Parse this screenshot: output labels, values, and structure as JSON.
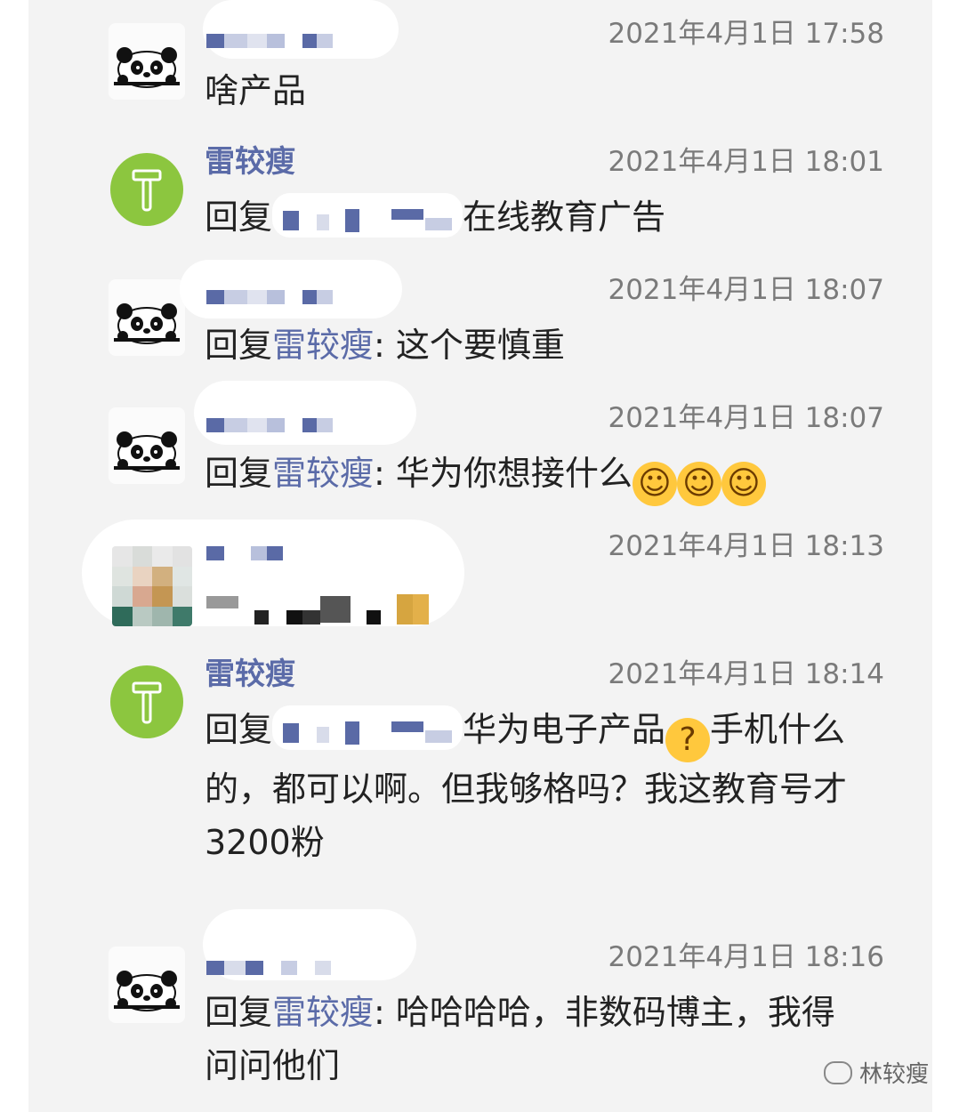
{
  "messages": [
    {
      "sender": "",
      "time": "2021年4月1日 17:58",
      "text": "啥产品"
    },
    {
      "sender": "雷较瘦",
      "time": "2021年4月1日 18:01",
      "reply_prefix": "回复",
      "text": "在线教育广告"
    },
    {
      "sender": "",
      "time": "2021年4月1日 18:07",
      "reply_prefix": "回复",
      "mention": "雷较瘦",
      "text": ": 这个要慎重"
    },
    {
      "sender": "",
      "time": "2021年4月1日 18:07",
      "reply_prefix": "回复",
      "mention": "雷较瘦",
      "text": ": 华为你想接什么"
    },
    {
      "sender": "",
      "time": "2021年4月1日 18:13",
      "text": ""
    },
    {
      "sender": "雷较瘦",
      "time": "2021年4月1日 18:14",
      "reply_prefix": "回复",
      "text_line1": "华为电子产品",
      "text_line1b": "手机什么",
      "text_line2": "的，都可以啊。但我够格吗？我这教育号才",
      "text_line3": "3200粉"
    },
    {
      "sender": "",
      "time": "2021年4月1日 18:16",
      "reply_prefix": "回复",
      "mention": "雷较瘦",
      "text_line1": ": 哈哈哈哈，非数码博主，我得",
      "text_line2": "问问他们"
    }
  ],
  "watermark": "林较瘦",
  "colors": {
    "mention": "#5b6ba8",
    "avatar_green": "#8cc63f",
    "panel_bg": "#f3f3f3"
  },
  "icons": [
    "panda-avatar-icon",
    "hammer-icon",
    "laugh-emoji-icon",
    "thinking-emoji-icon",
    "wechat-icon"
  ]
}
